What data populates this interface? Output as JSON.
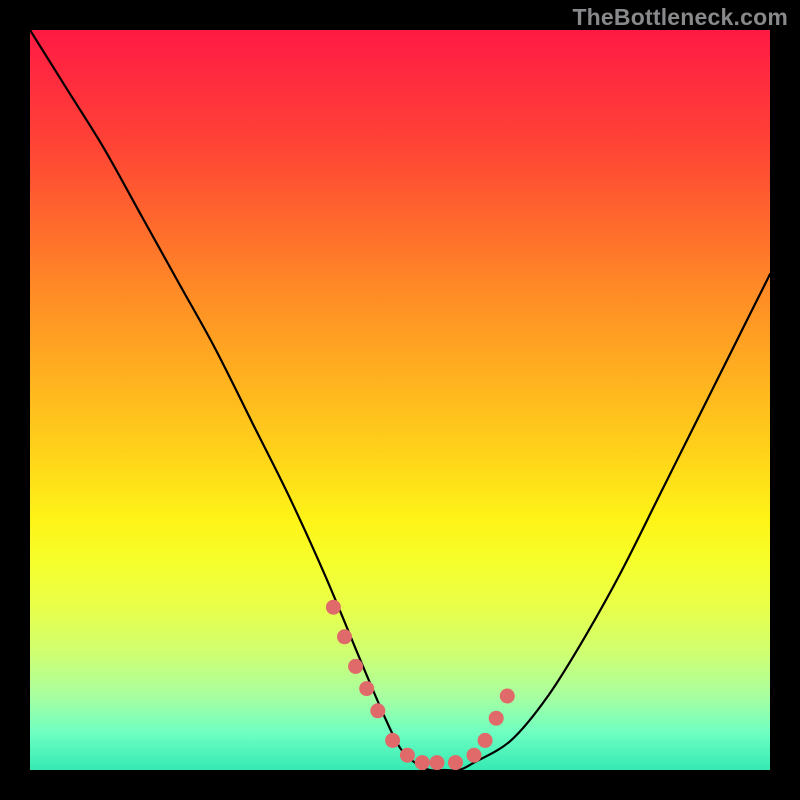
{
  "watermark": "TheBottleneck.com",
  "chart_data": {
    "type": "line",
    "title": "",
    "xlabel": "",
    "ylabel": "",
    "xlim": [
      0,
      100
    ],
    "ylim": [
      0,
      100
    ],
    "series": [
      {
        "name": "bottleneck-curve",
        "x": [
          0,
          5,
          10,
          15,
          20,
          25,
          30,
          35,
          40,
          45,
          48,
          50,
          52,
          54,
          56,
          58,
          60,
          65,
          70,
          75,
          80,
          85,
          90,
          95,
          100
        ],
        "values": [
          100,
          92,
          84,
          75,
          66,
          57,
          47,
          37,
          26,
          14,
          7,
          3,
          1,
          0,
          0,
          0,
          1,
          4,
          10,
          18,
          27,
          37,
          47,
          57,
          67
        ]
      }
    ],
    "markers": {
      "name": "highlight-points",
      "color": "#e06a6a",
      "x": [
        41,
        42.5,
        44,
        45.5,
        47,
        49,
        51,
        53,
        55,
        57.5,
        60,
        61.5,
        63,
        64.5
      ],
      "values": [
        22,
        18,
        14,
        11,
        8,
        4,
        2,
        1,
        1,
        1,
        2,
        4,
        7,
        10
      ]
    },
    "background": {
      "type": "vertical-gradient",
      "stops": [
        {
          "pct": 0,
          "color": "#ff1a44"
        },
        {
          "pct": 25,
          "color": "#ff652e"
        },
        {
          "pct": 57,
          "color": "#ffd21a"
        },
        {
          "pct": 78,
          "color": "#e8ff4a"
        },
        {
          "pct": 100,
          "color": "#35e9b3"
        }
      ]
    }
  }
}
